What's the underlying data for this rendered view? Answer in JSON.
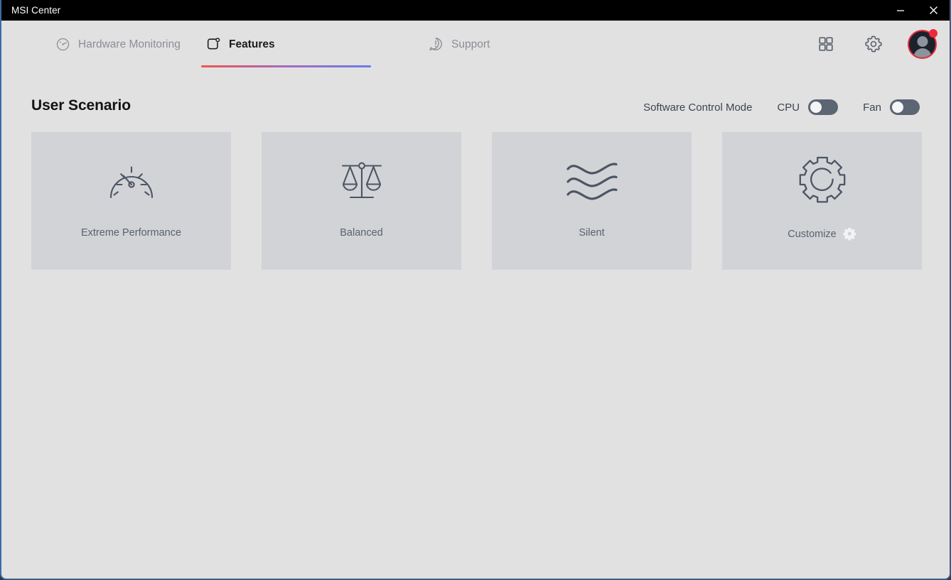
{
  "window": {
    "title": "MSI Center",
    "controls": [
      {
        "name": "minimize",
        "icon": "minimize-icon",
        "label": "–"
      },
      {
        "name": "close",
        "icon": "close-icon",
        "label": "✕"
      }
    ],
    "border_color": "#3a6ea5",
    "titlebar_color": "#000000",
    "background_color": "#e1e1e1"
  },
  "tabs": [
    {
      "id": "hardware-monitoring",
      "label": "Hardware Monitoring",
      "icon": "gauge-dial-icon",
      "active": false
    },
    {
      "id": "features",
      "label": "Features",
      "icon": "feature-widget-icon",
      "active": true
    },
    {
      "id": "support",
      "label": "Support",
      "icon": "speech-bubble-alert-icon",
      "active": false
    }
  ],
  "tab_active_underline": {
    "from_color": "#ef5350",
    "to_color": "#6b7ce8"
  },
  "top_actions": [
    {
      "id": "apps-grid",
      "icon": "grid-2x2-icon",
      "label": ""
    },
    {
      "id": "settings",
      "icon": "gear-icon",
      "label": ""
    },
    {
      "id": "account",
      "icon": "user-avatar-icon",
      "label": "",
      "has_notification": true,
      "ring_color": "#ea2e3f"
    }
  ],
  "main": {
    "page_title": "User Scenario",
    "control_mode": {
      "label": "Software Control Mode",
      "toggles": [
        {
          "id": "cpu",
          "label": "CPU",
          "state": "off"
        },
        {
          "id": "fan",
          "label": "Fan",
          "state": "off"
        }
      ],
      "track_color_off": "#5c6573",
      "knob_color": "#f4f5f7"
    },
    "scenarios": [
      {
        "id": "extreme-performance",
        "label": "Extreme Performance",
        "icon": "speedometer-icon",
        "selected": false,
        "has_settings_gear": false
      },
      {
        "id": "balanced",
        "label": "Balanced",
        "icon": "balance-scale-icon",
        "selected": false,
        "has_settings_gear": false
      },
      {
        "id": "silent",
        "label": "Silent",
        "icon": "wave-lines-icon",
        "selected": false,
        "has_settings_gear": false
      },
      {
        "id": "customize",
        "label": "Customize",
        "icon": "gear-outline-icon",
        "selected": false,
        "has_settings_gear": true,
        "gear_icon": "small-gear-icon"
      }
    ],
    "card_color": "#d1d3d7",
    "card_label_color": "#5a626e",
    "icon_stroke_color": "#4d5563"
  }
}
